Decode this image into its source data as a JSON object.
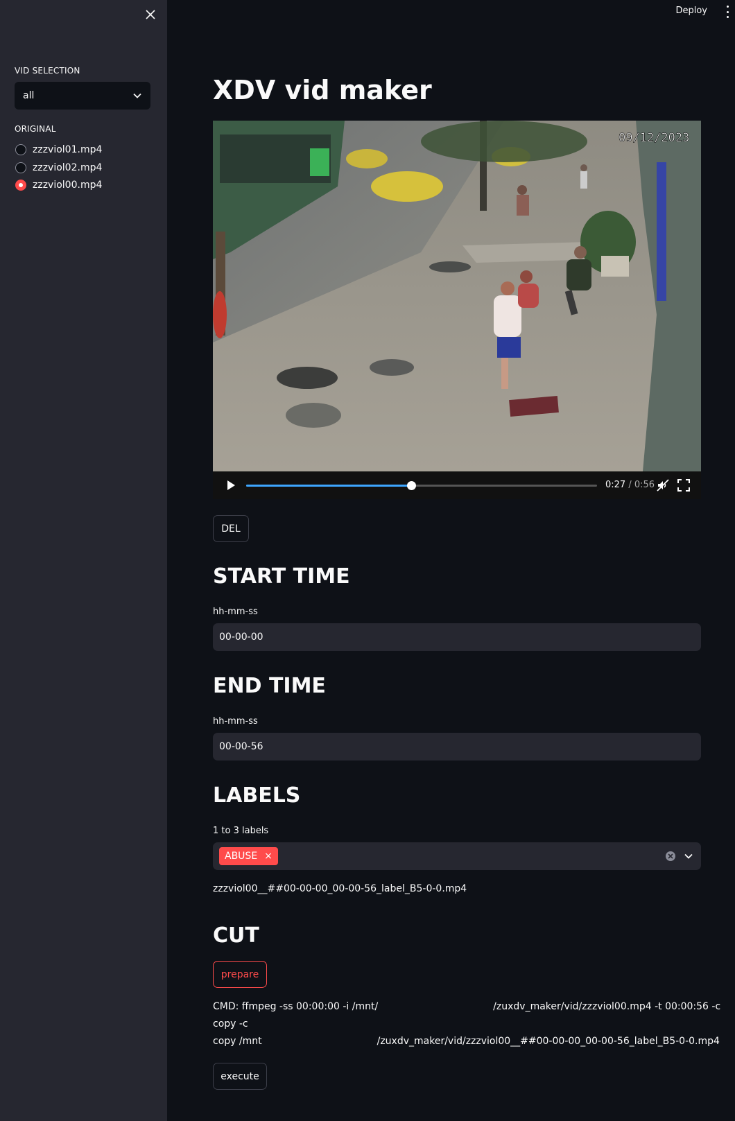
{
  "sidebar": {
    "close_icon": "close-icon",
    "vid_selection_label": "VID SELECTION",
    "select_value": "all",
    "original_label": "ORIGINAL",
    "files": [
      {
        "label": "zzzviol01.mp4",
        "checked": false
      },
      {
        "label": "zzzviol02.mp4",
        "checked": false
      },
      {
        "label": "zzzviol00.mp4",
        "checked": true
      }
    ]
  },
  "header": {
    "deploy_label": "Deploy",
    "menu_icon": "vertical-dots-icon"
  },
  "main": {
    "title": "XDV vid maker",
    "video": {
      "overlay_date": "09/12/2023",
      "current_time": "0:27",
      "separator": "/",
      "duration": "0:56",
      "progress_fraction": 0.47
    },
    "del_button": "DEL",
    "start": {
      "heading": "START TIME",
      "label": "hh-mm-ss",
      "value": "00-00-00"
    },
    "end": {
      "heading": "END TIME",
      "label": "hh-mm-ss",
      "value": "00-00-56"
    },
    "labels": {
      "heading": "LABELS",
      "label": "1 to 3 labels",
      "tags": [
        "ABUSE"
      ]
    },
    "output_filename": "zzzviol00__##00-00-00_00-00-56_label_B5-0-0.mp4",
    "cut": {
      "heading": "CUT",
      "prepare_button": "prepare",
      "cmd_line1_a": "CMD: ffmpeg -ss 00:00:00 -i /mnt/",
      "cmd_line1_b": "/zuxdv_maker/vid/zzzviol00.mp4 -t 00:00:56 -c",
      "cmd_line2": "copy -c",
      "cmd_line3_a": "copy /mnt",
      "cmd_line3_b": "/zuxdv_maker/vid/zzzviol00__##00-00-00_00-00-56_label_B5-0-0.mp4",
      "execute_button": "execute"
    }
  },
  "colors": {
    "accent": "#ff4b4b",
    "background": "#0e1117",
    "sidebar": "#262730",
    "progress": "#3ea6ff"
  }
}
